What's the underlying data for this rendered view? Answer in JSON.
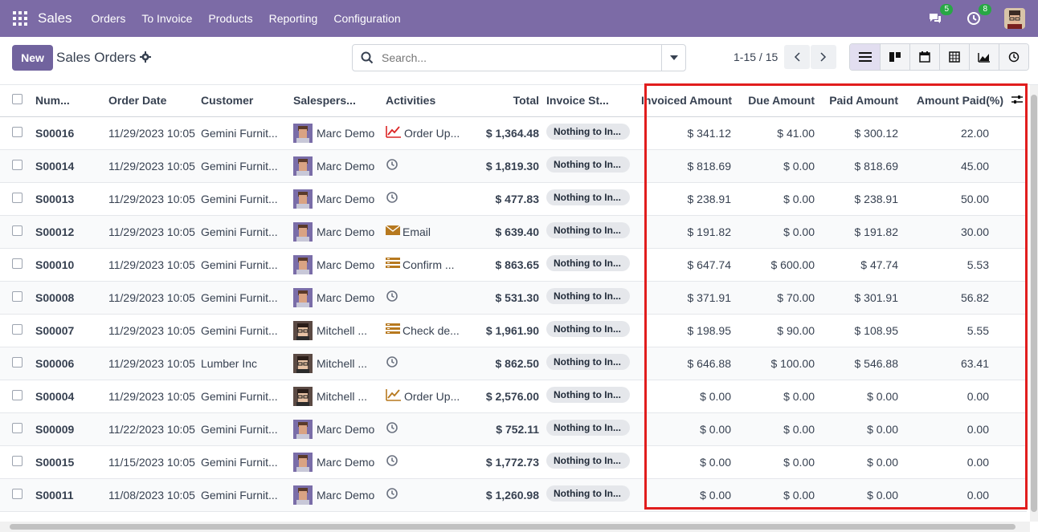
{
  "navbar": {
    "app": "Sales",
    "menu": [
      "Orders",
      "To Invoice",
      "Products",
      "Reporting",
      "Configuration"
    ],
    "chat_count": "5",
    "activity_count": "8"
  },
  "control": {
    "new_label": "New",
    "title": "Sales Orders",
    "search_placeholder": "Search...",
    "pager": "1-15 / 15"
  },
  "table": {
    "headers": {
      "number": "Num...",
      "order_date": "Order Date",
      "customer": "Customer",
      "salesperson": "Salespers...",
      "activities": "Activities",
      "total": "Total",
      "invoice_status": "Invoice St...",
      "invoiced_amount": "Invoiced Amount",
      "due_amount": "Due Amount",
      "paid_amount": "Paid Amount",
      "amount_paid_pct": "Amount Paid(%)"
    },
    "rows": [
      {
        "number": "S00016",
        "date": "11/29/2023 10:05",
        "customer": "Gemini Furnit...",
        "salesperson": "Marc Demo",
        "sp_avatar": "marc",
        "activity_icon": "trend-chart-icon",
        "activity_color": "#dc2626",
        "activity": "Order Up...",
        "total": "$ 1,364.48",
        "total_bold": true,
        "invoice_status": "Nothing to In...",
        "invoiced": "$ 341.12",
        "due": "$ 41.00",
        "paid": "$ 300.12",
        "pct": "22.00"
      },
      {
        "number": "S00014",
        "date": "11/29/2023 10:05",
        "customer": "Gemini Furnit...",
        "salesperson": "Marc Demo",
        "sp_avatar": "marc",
        "activity_icon": "clock-icon",
        "activity_color": "#6b7280",
        "activity": "",
        "total": "$ 1,819.30",
        "total_bold": true,
        "invoice_status": "Nothing to In...",
        "invoiced": "$ 818.69",
        "due": "$ 0.00",
        "paid": "$ 818.69",
        "pct": "45.00"
      },
      {
        "number": "S00013",
        "date": "11/29/2023 10:05",
        "customer": "Gemini Furnit...",
        "salesperson": "Marc Demo",
        "sp_avatar": "marc",
        "activity_icon": "clock-icon",
        "activity_color": "#6b7280",
        "activity": "",
        "total": "$ 477.83",
        "total_bold": true,
        "invoice_status": "Nothing to In...",
        "invoiced": "$ 238.91",
        "due": "$ 0.00",
        "paid": "$ 238.91",
        "pct": "50.00"
      },
      {
        "number": "S00012",
        "date": "11/29/2023 10:05",
        "customer": "Gemini Furnit...",
        "salesperson": "Marc Demo",
        "sp_avatar": "marc",
        "activity_icon": "envelope-icon",
        "activity_color": "#b7791f",
        "activity": "Email",
        "total": "$ 639.40",
        "total_bold": true,
        "invoice_status": "Nothing to In...",
        "invoiced": "$ 191.82",
        "due": "$ 0.00",
        "paid": "$ 191.82",
        "pct": "30.00"
      },
      {
        "number": "S00010",
        "date": "11/29/2023 10:05",
        "customer": "Gemini Furnit...",
        "salesperson": "Marc Demo",
        "sp_avatar": "marc",
        "activity_icon": "tasks-icon",
        "activity_color": "#b7791f",
        "activity": "Confirm ...",
        "total": "$ 863.65",
        "total_bold": true,
        "invoice_status": "Nothing to In...",
        "invoiced": "$ 647.74",
        "due": "$ 600.00",
        "paid": "$ 47.74",
        "pct": "5.53"
      },
      {
        "number": "S00008",
        "date": "11/29/2023 10:05",
        "customer": "Gemini Furnit...",
        "salesperson": "Marc Demo",
        "sp_avatar": "marc",
        "activity_icon": "clock-icon",
        "activity_color": "#6b7280",
        "activity": "",
        "total": "$ 531.30",
        "total_bold": true,
        "invoice_status": "Nothing to In...",
        "invoiced": "$ 371.91",
        "due": "$ 70.00",
        "paid": "$ 301.91",
        "pct": "56.82"
      },
      {
        "number": "S00007",
        "date": "11/29/2023 10:05",
        "customer": "Gemini Furnit...",
        "salesperson": "Mitchell ...",
        "sp_avatar": "mitchell",
        "activity_icon": "tasks-icon",
        "activity_color": "#b7791f",
        "activity": "Check de...",
        "total": "$ 1,961.90",
        "total_bold": true,
        "invoice_status": "Nothing to In...",
        "invoiced": "$ 198.95",
        "due": "$ 90.00",
        "paid": "$ 108.95",
        "pct": "5.55"
      },
      {
        "number": "S00006",
        "date": "11/29/2023 10:05",
        "customer": "Lumber Inc",
        "salesperson": "Mitchell ...",
        "sp_avatar": "mitchell",
        "activity_icon": "clock-icon",
        "activity_color": "#6b7280",
        "activity": "",
        "total": "$ 862.50",
        "total_bold": true,
        "invoice_status": "Nothing to In...",
        "invoiced": "$ 646.88",
        "due": "$ 100.00",
        "paid": "$ 546.88",
        "pct": "63.41"
      },
      {
        "number": "S00004",
        "date": "11/29/2023 10:05",
        "customer": "Gemini Furnit...",
        "salesperson": "Mitchell ...",
        "sp_avatar": "mitchell",
        "activity_icon": "trend-chart-icon",
        "activity_color": "#b7791f",
        "activity": "Order Up...",
        "total": "$ 2,576.00",
        "total_bold": true,
        "invoice_status": "Nothing to In...",
        "invoiced": "$ 0.00",
        "due": "$ 0.00",
        "paid": "$ 0.00",
        "pct": "0.00"
      },
      {
        "number": "S00009",
        "date": "11/22/2023 10:05",
        "customer": "Gemini Furnit...",
        "salesperson": "Marc Demo",
        "sp_avatar": "marc",
        "activity_icon": "clock-icon",
        "activity_color": "#6b7280",
        "activity": "",
        "total": "$ 752.11",
        "total_bold": true,
        "invoice_status": "Nothing to In...",
        "invoiced": "$ 0.00",
        "due": "$ 0.00",
        "paid": "$ 0.00",
        "pct": "0.00"
      },
      {
        "number": "S00015",
        "date": "11/15/2023 10:05",
        "customer": "Gemini Furnit...",
        "salesperson": "Marc Demo",
        "sp_avatar": "marc",
        "activity_icon": "clock-icon",
        "activity_color": "#6b7280",
        "activity": "",
        "total": "$ 1,772.73",
        "total_bold": true,
        "invoice_status": "Nothing to In...",
        "invoiced": "$ 0.00",
        "due": "$ 0.00",
        "paid": "$ 0.00",
        "pct": "0.00"
      },
      {
        "number": "S00011",
        "date": "11/08/2023 10:05",
        "customer": "Gemini Furnit...",
        "salesperson": "Marc Demo",
        "sp_avatar": "marc",
        "activity_icon": "clock-icon",
        "activity_color": "#6b7280",
        "activity": "",
        "total": "$ 1,260.98",
        "total_bold": true,
        "invoice_status": "Nothing to In...",
        "invoiced": "$ 0.00",
        "due": "$ 0.00",
        "paid": "$ 0.00",
        "pct": "0.00"
      }
    ]
  },
  "colors": {
    "navbar": "#7c6ba6",
    "primary_button": "#71639e",
    "highlight_border": "#e11d1d",
    "badge": "#28a745"
  }
}
